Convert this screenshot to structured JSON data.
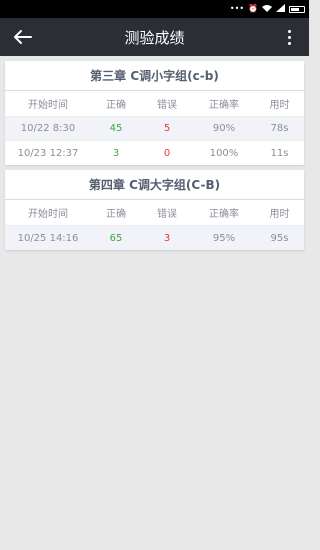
{
  "status_bar": {
    "icons": [
      "dots-icon",
      "alarm-icon",
      "wifi-icon",
      "signal-icon",
      "battery-icon"
    ]
  },
  "app_bar": {
    "title": "测验成绩",
    "back_icon": "arrow-left-icon",
    "menu_icon": "more-vertical-icon"
  },
  "columns": {
    "time": "开始时间",
    "correct": "正确",
    "wrong": "错误",
    "rate": "正确率",
    "duration": "用时"
  },
  "colors": {
    "app_bar": "#2b2e35",
    "correct": "#3aa844",
    "wrong": "#e03c3c",
    "title": "#555e70"
  },
  "sections": [
    {
      "title": "第三章 C调小字组(c-b)",
      "rows": [
        {
          "time": "10/22 8:30",
          "correct": "45",
          "wrong": "5",
          "rate": "90%",
          "duration": "78s"
        },
        {
          "time": "10/23 12:37",
          "correct": "3",
          "wrong": "0",
          "rate": "100%",
          "duration": "11s"
        }
      ]
    },
    {
      "title": "第四章 C调大字组(C-B)",
      "rows": [
        {
          "time": "10/25 14:16",
          "correct": "65",
          "wrong": "3",
          "rate": "95%",
          "duration": "95s"
        }
      ]
    }
  ]
}
